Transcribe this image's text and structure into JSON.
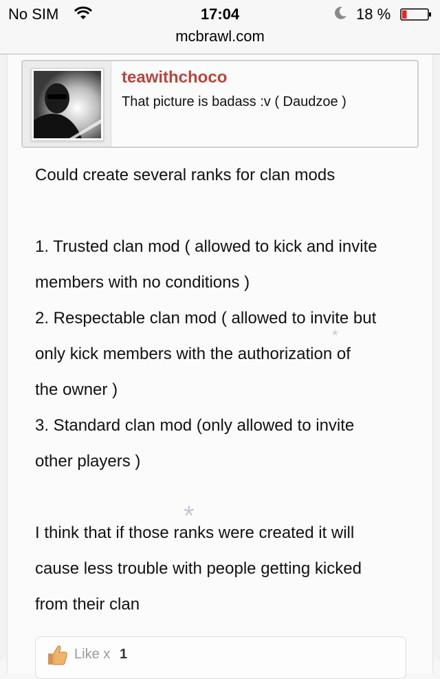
{
  "status_bar": {
    "carrier": "No SIM",
    "time": "17:04",
    "battery_percent": "18 %",
    "battery_level": 0.18,
    "battery_color": "#e8261f"
  },
  "browser": {
    "url": "mcbrawl.com"
  },
  "post": {
    "quote": {
      "username": "teawithchoco",
      "text": "That picture is badass :v ( Daudzoe )",
      "username_color": "#b8463c"
    },
    "body": [
      "Could create several ranks for clan mods",
      "",
      "1. Trusted clan mod ( allowed to kick and invite",
      "members with no conditions )",
      "2. Respectable clan mod ( allowed to invite but",
      "only kick members with the authorization of",
      "the owner )",
      "3. Standard clan mod (only allowed to invite",
      "other players )",
      "",
      "I think that if those ranks were created it will",
      "cause less trouble with people getting kicked",
      "from their clan"
    ],
    "likes": {
      "label": "Like x",
      "count": "1"
    }
  },
  "icons": {
    "wifi": "wifi-icon",
    "moon": "do-not-disturb-moon-icon",
    "battery": "battery-icon",
    "thumb": "thumbs-up-icon",
    "sparkle": "asterisk-icon"
  }
}
